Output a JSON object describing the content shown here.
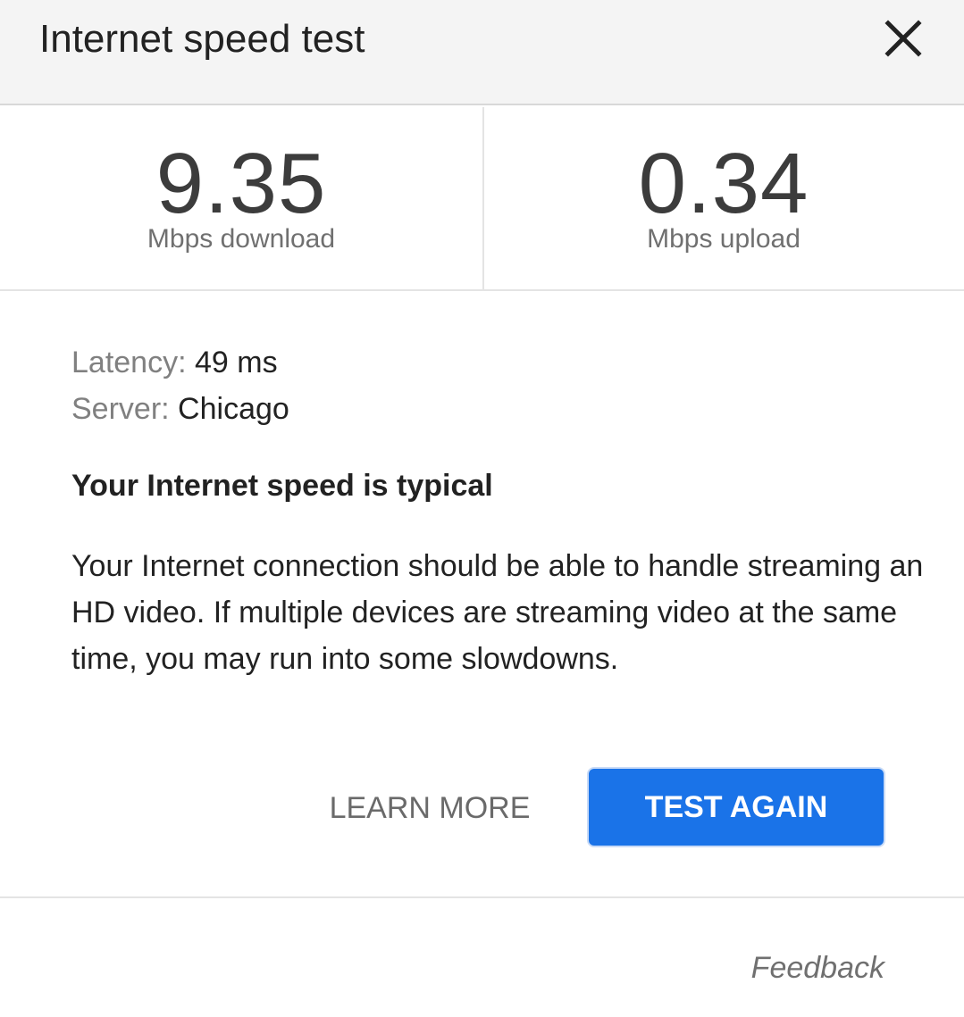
{
  "header": {
    "title": "Internet speed test",
    "close_icon": "close-icon"
  },
  "results": {
    "download": {
      "value": "9.35",
      "label": "Mbps download"
    },
    "upload": {
      "value": "0.34",
      "label": "Mbps upload"
    }
  },
  "details": {
    "latency_key": "Latency:",
    "latency_value": "49 ms",
    "server_key": "Server:",
    "server_value": "Chicago"
  },
  "summary": {
    "headline": "Your Internet speed is typical",
    "description": "Your Internet connection should be able to handle streaming an HD video. If multiple devices are streaming video at the same time, you may run into some slowdowns."
  },
  "actions": {
    "learn_more_label": "LEARN MORE",
    "test_again_label": "TEST AGAIN"
  },
  "footer": {
    "feedback_label": "Feedback"
  },
  "colors": {
    "accent": "#1a73e8",
    "header_bg": "#f4f4f4"
  }
}
